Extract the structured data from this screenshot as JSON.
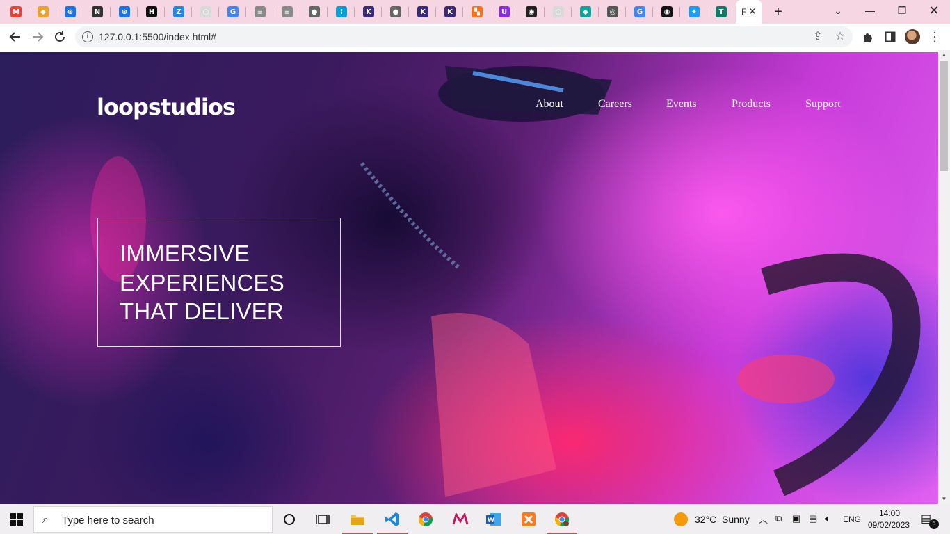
{
  "browser": {
    "tabs": [
      {
        "icon": "gmail-icon",
        "color": "#ea4335",
        "glyph": "M"
      },
      {
        "icon": "maps-colorful-icon",
        "color": "#e8a12c",
        "glyph": "◆"
      },
      {
        "icon": "globe-blue-icon",
        "color": "#1a73e8",
        "glyph": "⊛"
      },
      {
        "icon": "news-icon",
        "color": "#333333",
        "glyph": "N"
      },
      {
        "icon": "translate-icon",
        "color": "#1a73e8",
        "glyph": "⊛"
      },
      {
        "icon": "hackernoon-icon",
        "color": "#111111",
        "glyph": "H"
      },
      {
        "icon": "blue-circle-icon",
        "color": "#1e88e5",
        "glyph": "Z"
      },
      {
        "icon": "light-page-icon",
        "color": "#d9d9d9",
        "glyph": "○"
      },
      {
        "icon": "google-icon",
        "color": "#4285f4",
        "glyph": "G"
      },
      {
        "icon": "document-icon",
        "color": "#888888",
        "glyph": "≡"
      },
      {
        "icon": "document-icon",
        "color": "#888888",
        "glyph": "≡"
      },
      {
        "icon": "globe-grey-icon",
        "color": "#666666",
        "glyph": "●"
      },
      {
        "icon": "cisco-icon",
        "color": "#049fd9",
        "glyph": "⁞"
      },
      {
        "icon": "k-app-icon",
        "color": "#3b2a7a",
        "glyph": "K"
      },
      {
        "icon": "globe-grey-icon",
        "color": "#666666",
        "glyph": "●"
      },
      {
        "icon": "k-app-icon",
        "color": "#3b2a7a",
        "glyph": "K"
      },
      {
        "icon": "k-app-icon",
        "color": "#3b2a7a",
        "glyph": "K"
      },
      {
        "icon": "orange-squares-icon",
        "color": "#f4711f",
        "glyph": "▚"
      },
      {
        "icon": "purple-u-icon",
        "color": "#8a2be2",
        "glyph": "U"
      },
      {
        "icon": "github-icon",
        "color": "#222222",
        "glyph": "◉"
      },
      {
        "icon": "light-page-icon",
        "color": "#d9d9d9",
        "glyph": "○"
      },
      {
        "icon": "teal-diamond-icon",
        "color": "#11a39a",
        "glyph": "◆"
      },
      {
        "icon": "chrome-grey-icon",
        "color": "#555555",
        "glyph": "◎"
      },
      {
        "icon": "google-icon",
        "color": "#4285f4",
        "glyph": "G"
      },
      {
        "icon": "dark-circle-icon",
        "color": "#111111",
        "glyph": "◉"
      },
      {
        "icon": "twitter-icon",
        "color": "#1d9bf0",
        "glyph": "✦"
      },
      {
        "icon": "tp-icon",
        "color": "#0f7a6a",
        "glyph": "T"
      }
    ],
    "active_tab_glyph": "F",
    "address": "127.0.0.1:5500/index.html#"
  },
  "site": {
    "logo": "loopstudios",
    "nav": [
      "About",
      "Careers",
      "Events",
      "Products",
      "Support"
    ],
    "hero_lines": [
      "IMMERSIVE",
      "EXPERIENCES",
      "THAT DELIVER"
    ]
  },
  "taskbar": {
    "search_placeholder": "Type here to search",
    "weather_temp": "32°C",
    "weather_text": "Sunny",
    "language": "ENG",
    "time": "14:00",
    "date": "09/02/2023",
    "notifications": "3"
  }
}
